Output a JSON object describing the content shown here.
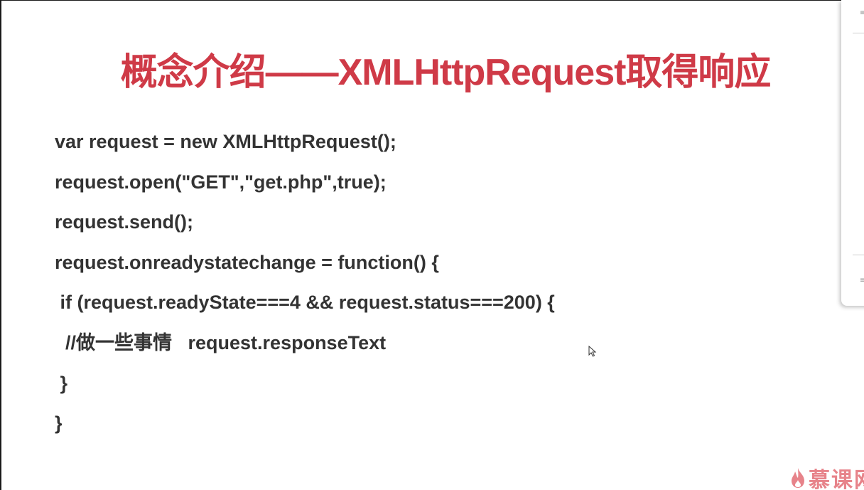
{
  "slide": {
    "title": "概念介绍——XMLHttpRequest取得响应",
    "code_lines": [
      "var request = new XMLHttpRequest();",
      "request.open(\"GET\",\"get.php\",true);",
      "request.send();",
      "request.onreadystatechange = function() {",
      " if (request.readyState===4 && request.status===200) {",
      "  //做一些事情   request.responseText",
      " }",
      "}"
    ]
  },
  "watermark": {
    "text": "慕课网",
    "icon": "flame-logo-icon"
  },
  "colors": {
    "title": "#cf3a47",
    "code": "#333333",
    "watermark": "#e7838a"
  }
}
